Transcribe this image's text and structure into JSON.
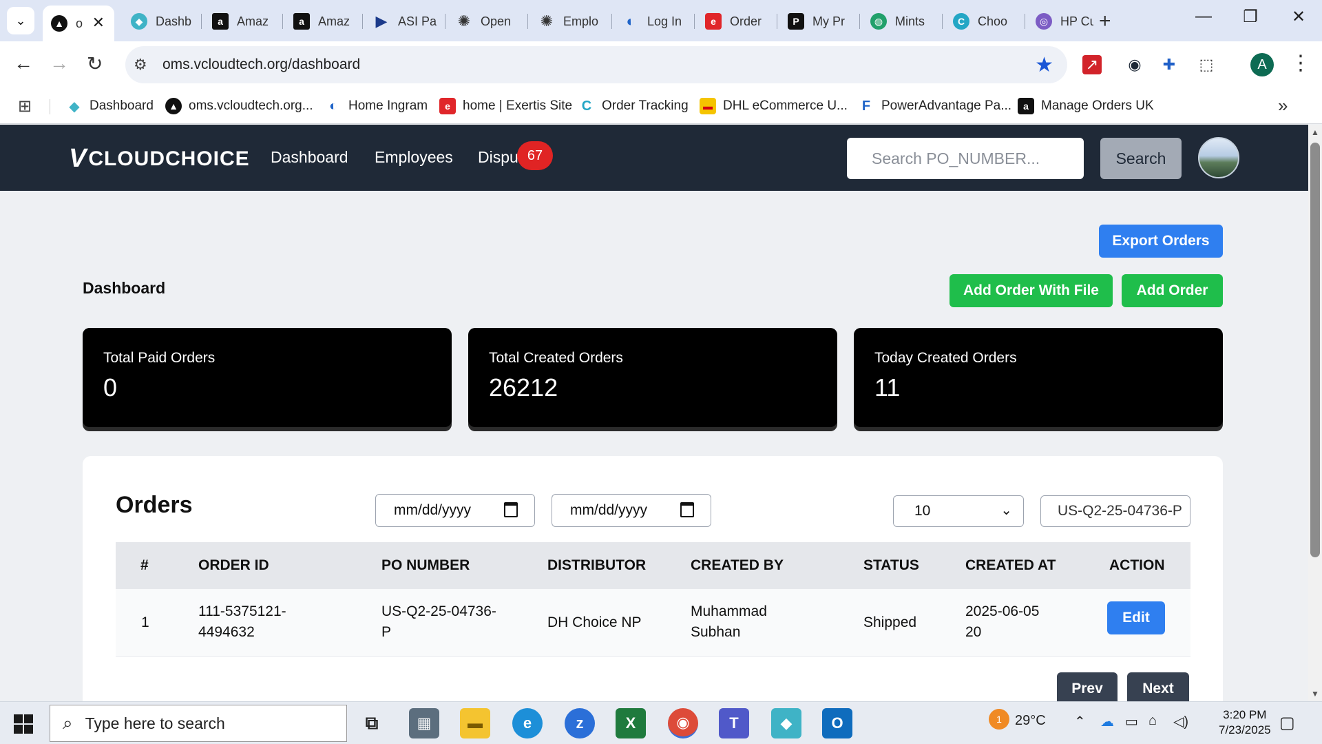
{
  "browser": {
    "tabs": [
      {
        "title": "o",
        "active": true,
        "fav_color": "#111111",
        "fav_glyph": "▲"
      },
      {
        "title": "Dashb",
        "fav_color": "#3fb3c6",
        "fav_glyph": "◆"
      },
      {
        "title": "Amaz",
        "fav_color": "#111111",
        "fav_glyph": "a"
      },
      {
        "title": "Amaz",
        "fav_color": "#111111",
        "fav_glyph": "a"
      },
      {
        "title": "ASI Pa",
        "fav_color": "#1b3a8a",
        "fav_glyph": "▶"
      },
      {
        "title": "Open",
        "fav_color": "#333333",
        "fav_glyph": "✺"
      },
      {
        "title": "Emplo",
        "fav_color": "#333333",
        "fav_glyph": "✺"
      },
      {
        "title": "Log In",
        "fav_color": "#1f64c8",
        "fav_glyph": "◐"
      },
      {
        "title": "Order",
        "fav_color": "#e0262a",
        "fav_glyph": "e"
      },
      {
        "title": "My Pr",
        "fav_color": "#111111",
        "fav_glyph": "P"
      },
      {
        "title": "Mints",
        "fav_color": "#21a06b",
        "fav_glyph": "◍"
      },
      {
        "title": "Choo",
        "fav_color": "#23a6c5",
        "fav_glyph": "C"
      },
      {
        "title": "HP Cu",
        "fav_color": "#7c5cc4",
        "fav_glyph": "◎"
      }
    ],
    "url": "oms.vcloudtech.org/dashboard",
    "profile_initial": "A",
    "bookmarks": [
      {
        "label": "Dashboard",
        "color": "#3fb3c6",
        "glyph": "◆"
      },
      {
        "label": "oms.vcloudtech.org...",
        "color": "#111111",
        "glyph": "▲"
      },
      {
        "label": "Home Ingram",
        "color": "#1f64c8",
        "glyph": "◐"
      },
      {
        "label": "home | Exertis Site",
        "color": "#e0262a",
        "glyph": "e"
      },
      {
        "label": "Order Tracking",
        "color": "#23a6c5",
        "glyph": "C"
      },
      {
        "label": "DHL eCommerce U...",
        "color": "#f5c400",
        "glyph": "▬"
      },
      {
        "label": "PowerAdvantage Pa...",
        "color": "#1f64c8",
        "glyph": "F"
      },
      {
        "label": "Manage Orders UK",
        "color": "#111111",
        "glyph": "a"
      }
    ]
  },
  "app": {
    "logo_v": "V",
    "logo_text": "CLOUDCHOICE",
    "nav": {
      "dashboard": "Dashboard",
      "employees": "Employees",
      "disputes": "Dispu",
      "disputes_badge": "67"
    },
    "search": {
      "placeholder": "Search PO_NUMBER...",
      "button": "Search"
    },
    "actions": {
      "export": "Export Orders",
      "add_with_file": "Add Order With File",
      "add": "Add Order"
    },
    "page_title": "Dashboard",
    "stats": [
      {
        "label": "Total Paid Orders",
        "value": "0"
      },
      {
        "label": "Total Created Orders",
        "value": "26212"
      },
      {
        "label": "Today Created Orders",
        "value": "11"
      }
    ],
    "orders": {
      "title": "Orders",
      "date_from_placeholder": "mm/dd/yyyy",
      "date_to_placeholder": "mm/dd/yyyy",
      "page_size": "10",
      "filter_value": "US-Q2-25-04736-P",
      "columns": [
        "#",
        "ORDER ID",
        "PO NUMBER",
        "DISTRIBUTOR",
        "CREATED BY",
        "STATUS",
        "CREATED AT",
        "ACTION"
      ],
      "rows": [
        {
          "index": "1",
          "order_id_l1": "111-5375121-",
          "order_id_l2": "4494632",
          "po_l1": "US-Q2-25-04736-",
          "po_l2": "P",
          "distributor": "DH Choice NP",
          "created_by_l1": "Muhammad",
          "created_by_l2": "Subhan",
          "status": "Shipped",
          "created_at_l1": "2025-06-05",
          "created_at_l2": "20",
          "action": "Edit"
        }
      ],
      "prev": "Prev",
      "next": "Next"
    }
  },
  "taskbar": {
    "search_placeholder": "Type here to search",
    "weather": "29°C",
    "time": "3:20 PM",
    "date": "7/23/2025",
    "outlook_badge": "1"
  }
}
